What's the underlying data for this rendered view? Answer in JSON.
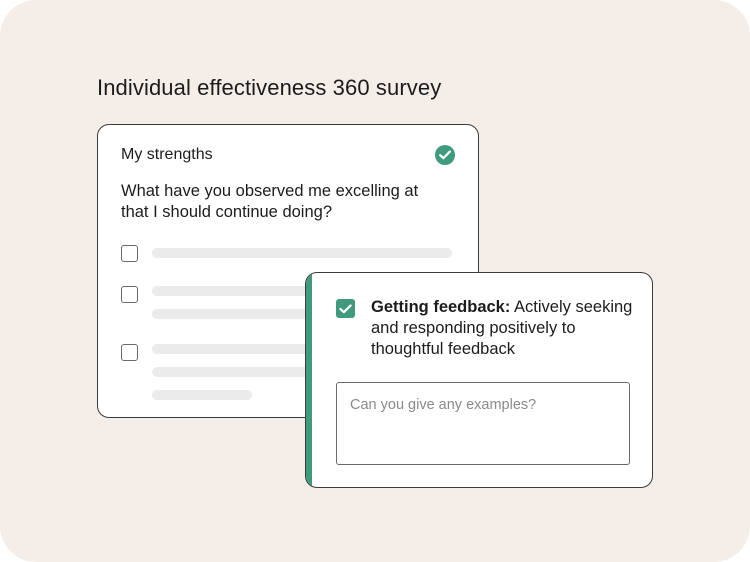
{
  "survey": {
    "title": "Individual effectiveness 360 survey"
  },
  "strengths_card": {
    "title": "My strengths",
    "completed_icon": "check-circle-icon",
    "question": "What have you observed me excelling at that I should continue doing?",
    "options": [
      {
        "checked": false
      },
      {
        "checked": false
      },
      {
        "checked": false
      }
    ]
  },
  "feedback_card": {
    "checked": true,
    "competency_name": "Getting feedback:",
    "competency_description": " Actively seeking and responding positively to thoughtful feedback",
    "input_placeholder": "Can you give any examples?"
  },
  "colors": {
    "background": "#f5eee8",
    "accent": "#3f9a7e",
    "border": "#3b3b3b",
    "placeholder_bar": "#ebebeb"
  }
}
